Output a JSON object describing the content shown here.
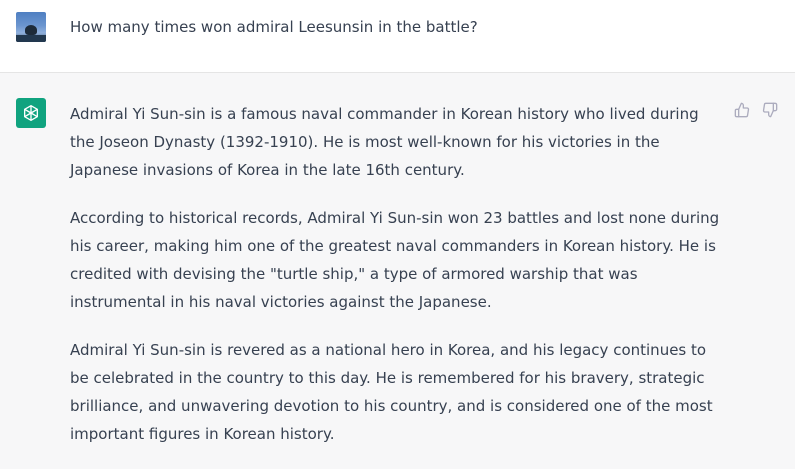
{
  "user": {
    "question": "How many times won admiral Leesunsin in the battle?"
  },
  "assistant": {
    "paragraphs": [
      "Admiral Yi Sun-sin is a famous naval commander in Korean history who lived during the Joseon Dynasty (1392-1910). He is most well-known for his victories in the Japanese invasions of Korea in the late 16th century.",
      "According to historical records, Admiral Yi Sun-sin won 23 battles and lost none during his career, making him one of the greatest naval commanders in Korean history. He is credited with devising the \"turtle ship,\" a type of armored warship that was instrumental in his naval victories against the Japanese.",
      "Admiral Yi Sun-sin is revered as a national hero in Korea, and his legacy continues to be celebrated in the country to this day. He is remembered for his bravery, strategic brilliance, and unwavering devotion to his country, and is considered one of the most important figures in Korean history."
    ]
  },
  "icons": {
    "assistant_logo": "openai-logo-icon",
    "thumbs_up": "thumbs-up-icon",
    "thumbs_down": "thumbs-down-icon"
  },
  "colors": {
    "assistant_bg": "#f7f7f8",
    "logo_bg": "#10a37f",
    "text": "#374151",
    "icon": "#acacbe"
  }
}
